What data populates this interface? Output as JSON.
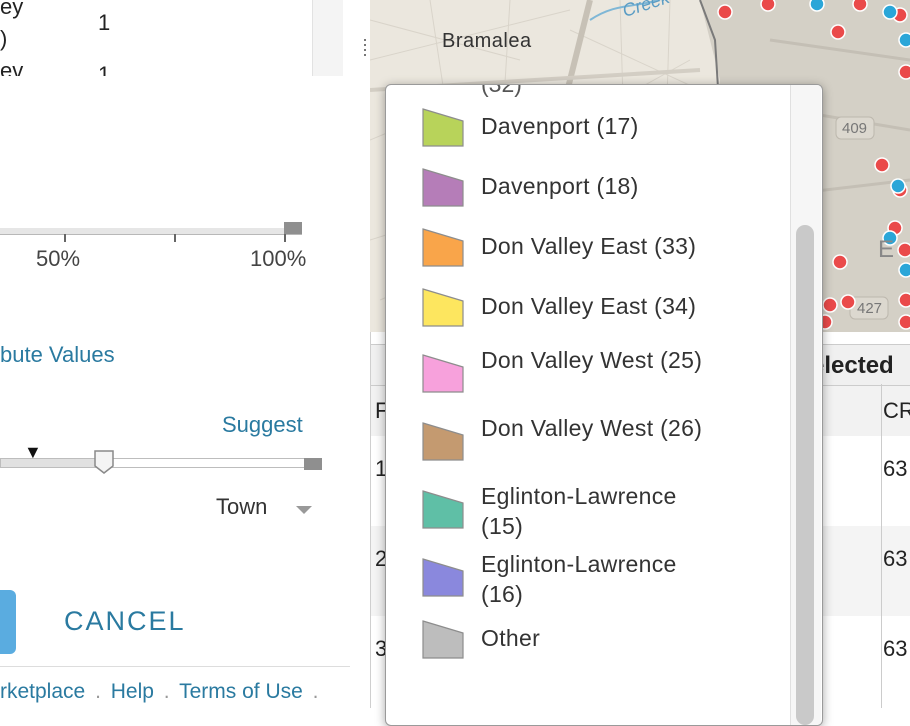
{
  "left_table": {
    "row1_label_a": "ey",
    "row1_label_b": ")",
    "row1_value": "1",
    "row2_label": "ev"
  },
  "opacity_slider": {
    "label_mid": "50%",
    "label_end": "100%"
  },
  "attribute_link": "bute Values",
  "suggest_link": "Suggest",
  "town_dropdown": {
    "value": "Town"
  },
  "buttons": {
    "cancel": "CANCEL"
  },
  "footer": {
    "links": [
      "rketplace",
      "Help",
      "Terms of Use"
    ],
    "separator": "."
  },
  "map": {
    "place_label": "Bramalea",
    "water_label": "Creek",
    "highway_409": "409",
    "highway_427": "427",
    "partial_label": "E"
  },
  "results": {
    "header_label": "elected",
    "column_f": "F",
    "column_cr": "CR",
    "rows": [
      {
        "idx": "1",
        "value": "63"
      },
      {
        "idx": "2",
        "value": "63"
      },
      {
        "idx": "3",
        "value": "63"
      }
    ]
  },
  "legend": {
    "cut_label": "(32)",
    "items": [
      {
        "label": "Davenport (17)",
        "color": "#b8d35a"
      },
      {
        "label": "Davenport (18)",
        "color": "#b57db8"
      },
      {
        "label": "Don Valley East (33)",
        "color": "#f9a54a"
      },
      {
        "label": "Don Valley East (34)",
        "color": "#fde65f"
      },
      {
        "label": "Don Valley West (25)",
        "color": "#f7a1dc"
      },
      {
        "label": "Don Valley West (26)",
        "color": "#c49a70"
      },
      {
        "label": "Eglinton-Lawrence (15)",
        "color": "#5fbfa6"
      },
      {
        "label": "Eglinton-Lawrence (16)",
        "color": "#8a88dd"
      },
      {
        "label": "Other",
        "color": "#bdbdbd"
      }
    ]
  },
  "colors": {
    "accent_link": "#2a7aa0",
    "map_point_red": "#ea4a4a",
    "map_point_blue": "#2aa6d8"
  }
}
